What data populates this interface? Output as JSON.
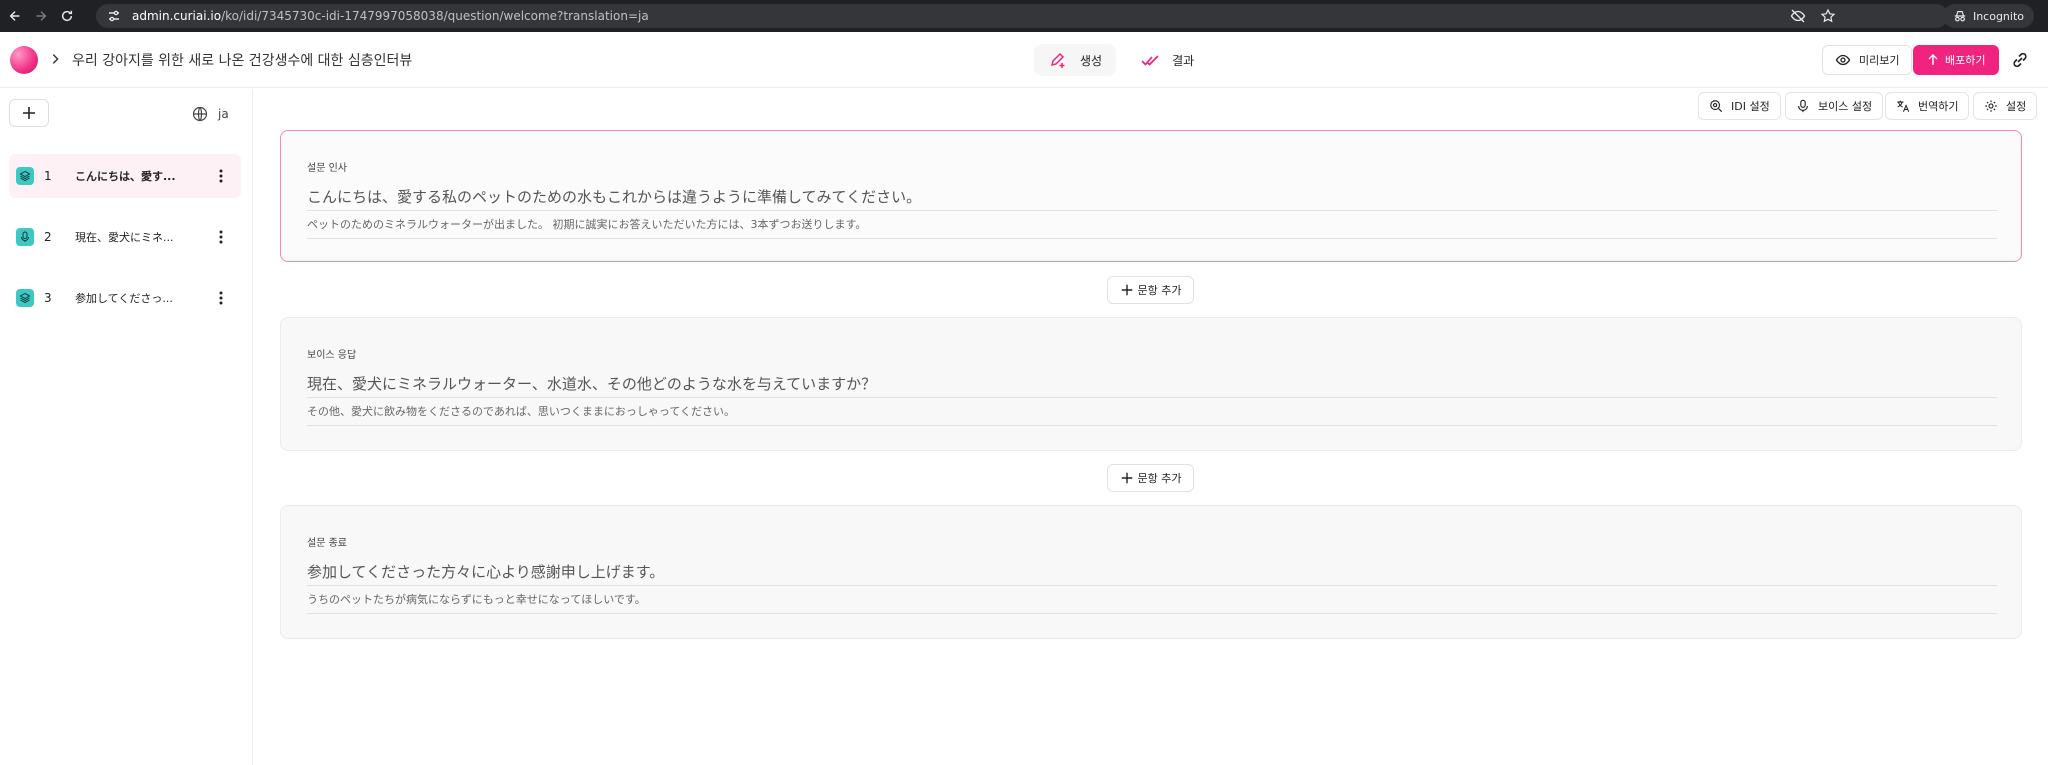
{
  "browser": {
    "url_host": "admin.curiai.io",
    "url_path": "/ko/idi/7345730c-idi-1747997058038/question/welcome?translation=ja",
    "incognito_label": "Incognito"
  },
  "header": {
    "survey_title": "우리 강아지를 위한 새로 나온 건강생수에 대한 심층인터뷰",
    "tabs": [
      {
        "label": "생성",
        "icon": "pen-plus-icon",
        "active": true
      },
      {
        "label": "결과",
        "icon": "double-check-icon",
        "active": false
      }
    ],
    "preview_label": "미리보기",
    "deploy_label": "배포하기"
  },
  "sidebar": {
    "language": "ja",
    "items": [
      {
        "number": "1",
        "label": "こんにちは、愛す...",
        "icon": "layers-icon",
        "active": true
      },
      {
        "number": "2",
        "label": "現在、愛犬にミネ...",
        "icon": "microphone-icon",
        "active": false
      },
      {
        "number": "3",
        "label": "参加してくださっ...",
        "icon": "layers-icon",
        "active": false
      }
    ]
  },
  "toolbar": {
    "idi_settings": "IDI 설정",
    "voice_settings": "보이스 설정",
    "translate": "번역하기",
    "settings": "설정"
  },
  "cards": [
    {
      "type": "설문 인사",
      "main": "こんにちは、愛する私のペットのための水もこれからは違うように準備してみてください。",
      "sub": "ペットのためのミネラルウォーターが出ました。 初期に誠実にお答えいただいた方には、3本ずつお送りします。"
    },
    {
      "type": "보이스 응답",
      "main": "現在、愛犬にミネラルウォーター、水道水、その他どのような水を与えていますか？",
      "sub": "その他、愛犬に飲み物をくださるのであれば、思いつくままにおっしゃってください。"
    },
    {
      "type": "설문 종료",
      "main": "参加してくださった方々に心より感謝申し上げます。",
      "sub": "うちのペットたちが病気にならずにもっと幸せになってほしいです。"
    }
  ],
  "add_sentence_label": "문항 추가",
  "colors": {
    "accent": "#f0247f",
    "icon_teal": "#3fc7c4",
    "active_border": "#f58aaf"
  }
}
